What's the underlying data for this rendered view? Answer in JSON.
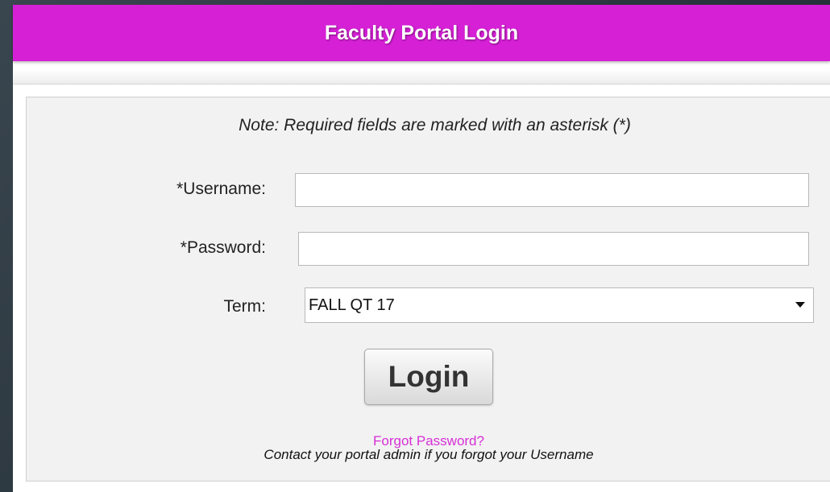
{
  "header": {
    "title": "Faculty Portal Login"
  },
  "form": {
    "note": "Note: Required fields are marked with an asterisk (*)",
    "username_label": "*Username:",
    "username_value": "",
    "password_label": "*Password:",
    "password_value": "",
    "term_label": "Term:",
    "term_selected": "FALL QT 17",
    "login_label": "Login",
    "forgot_password": "Forgot Password?",
    "contact_note": "Contact your portal admin if you forgot your Username"
  },
  "colors": {
    "header_bg": "#d620d6",
    "link": "#d630d6",
    "form_bg": "#f2f2f2"
  },
  "icons": {
    "term_dropdown": "chevron-down-icon"
  }
}
